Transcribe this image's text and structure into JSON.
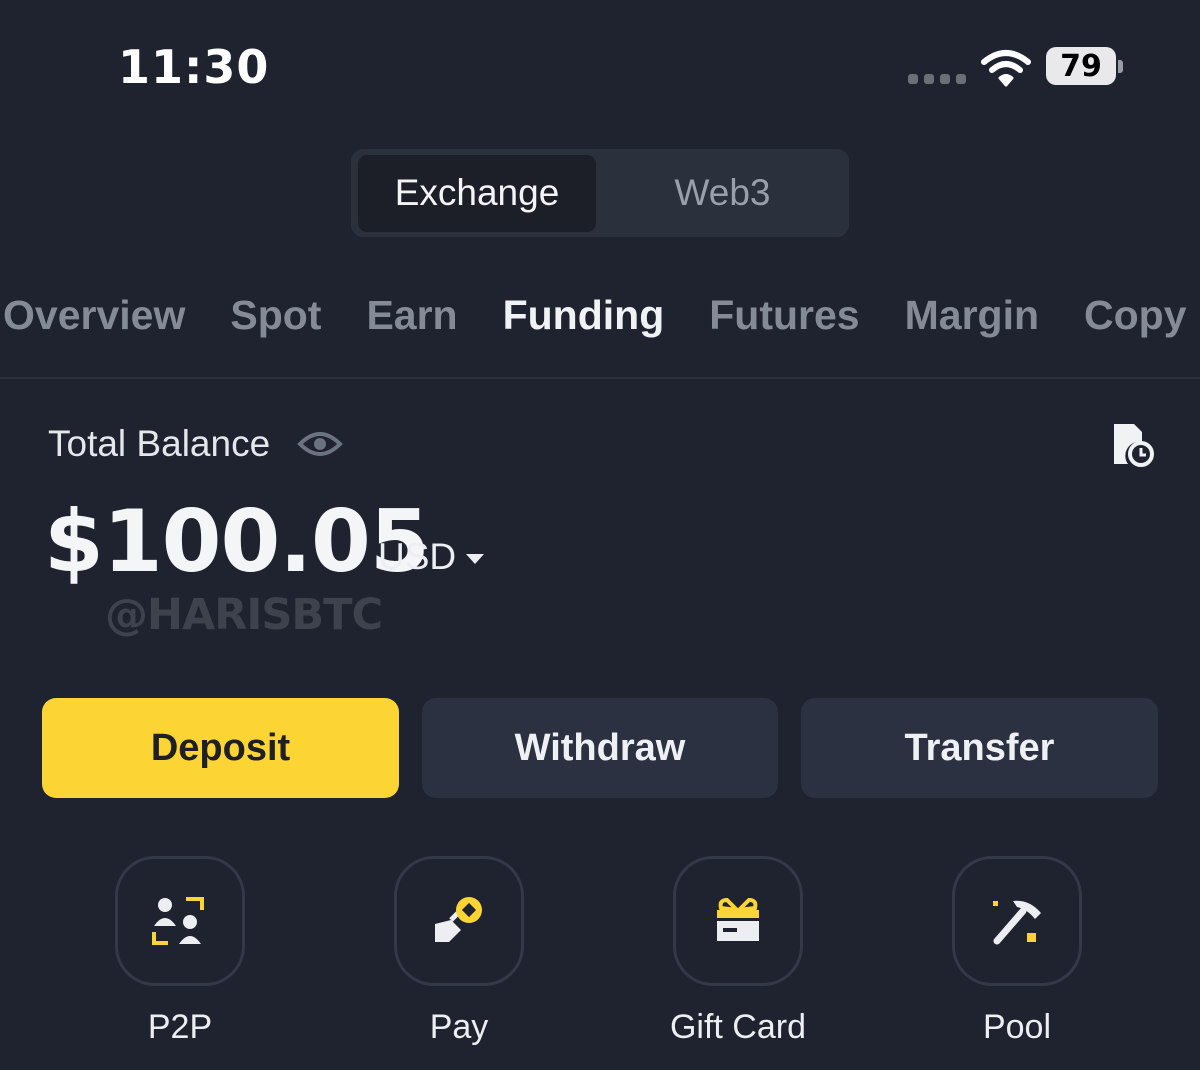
{
  "status_bar": {
    "time": "11:30",
    "battery": "79"
  },
  "mode_switch": {
    "options": [
      "Exchange",
      "Web3"
    ],
    "selected": "Exchange"
  },
  "tabs": {
    "items": [
      "Overview",
      "Spot",
      "Earn",
      "Funding",
      "Futures",
      "Margin",
      "Copy"
    ],
    "active": "Funding"
  },
  "balance": {
    "label": "Total Balance",
    "amount": "$100.05",
    "currency": "USD",
    "watermark": "@HARISBTC"
  },
  "actions": {
    "deposit": "Deposit",
    "withdraw": "Withdraw",
    "transfer": "Transfer"
  },
  "quick_actions": [
    {
      "label": "P2P",
      "icon": "p2p-icon"
    },
    {
      "label": "Pay",
      "icon": "pay-icon"
    },
    {
      "label": "Gift Card",
      "icon": "gift-card-icon"
    },
    {
      "label": "Pool",
      "icon": "pool-icon"
    }
  ],
  "colors": {
    "accent": "#fcd535",
    "background": "#1f2330",
    "button": "#2b3140"
  }
}
